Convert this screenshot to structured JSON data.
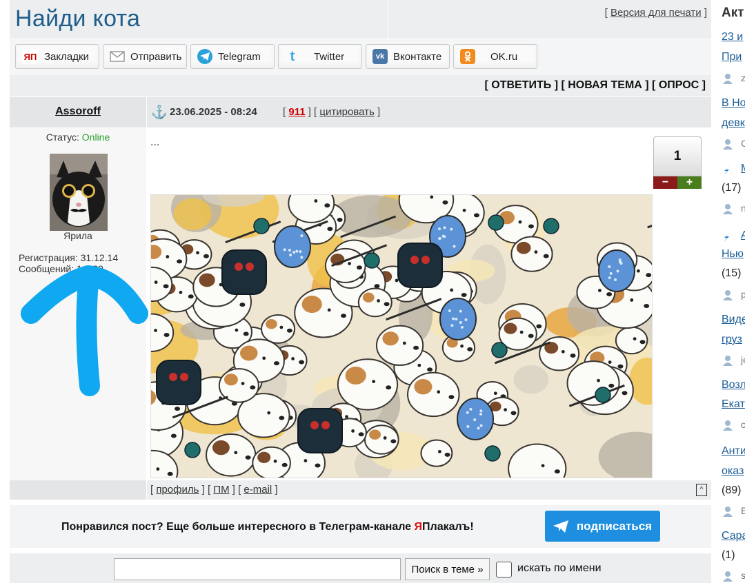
{
  "header": {
    "title": "Найди кота",
    "print_link": "Версия для печати"
  },
  "share": [
    {
      "label": "Закладки",
      "icon": "yap-icon"
    },
    {
      "label": "Отправить",
      "icon": "envelope-icon"
    },
    {
      "label": "Telegram",
      "icon": "telegram-icon"
    },
    {
      "label": "Twitter",
      "icon": "twitter-icon"
    },
    {
      "label": "Вконтакте",
      "icon": "vk-icon"
    },
    {
      "label": "OK.ru",
      "icon": "ok-icon"
    }
  ],
  "actions": "[ ОТВЕТИТЬ ] [ НОВАЯ ТЕМА ] [ ОПРОС ]",
  "post": {
    "author": "Assoroff",
    "date": "23.06.2025 - 08:24",
    "num": "911",
    "quote": "цитировать",
    "status_label": "Статус:",
    "status_value": "Online",
    "user_name": "Ярила",
    "reg_label": "Регистрация: 31.12.14",
    "msg_label": "Сообщений: 14929",
    "text": "...",
    "rating": "1",
    "rate_minus": "−",
    "rate_plus": "+",
    "links": {
      "profile": "профиль",
      "pm": "ПМ",
      "email": "e-mail"
    },
    "top_link": "^"
  },
  "promo": {
    "text_before": "Понравился пост? Еще больше интересного в Телеграм-канале ",
    "brand_r": "Я",
    "brand_rest": "Плакалъ!",
    "button": "подписаться"
  },
  "search": {
    "button": "Поиск в теме »",
    "checkbox_label": "искать по имени"
  },
  "sidebar": {
    "heading": "Акт",
    "lines": [
      {
        "text": "23 и",
        "type": "link"
      },
      {
        "text": "При",
        "type": "link"
      },
      {
        "text": "z",
        "type": "user"
      },
      {
        "text": "В Но",
        "type": "link"
      },
      {
        "text": "девк",
        "type": "link"
      },
      {
        "text": "С",
        "type": "user"
      },
      {
        "text": "М",
        "type": "arrow-link"
      },
      {
        "text": "(17)",
        "type": "count"
      },
      {
        "text": "n",
        "type": "user"
      },
      {
        "text": "А",
        "type": "arrow-link"
      },
      {
        "text": "Нью",
        "type": "link"
      },
      {
        "text": "(15)",
        "type": "count"
      },
      {
        "text": "р",
        "type": "user"
      },
      {
        "text": "Виде",
        "type": "link"
      },
      {
        "text": "груз",
        "type": "link"
      },
      {
        "text": "jє",
        "type": "user"
      },
      {
        "text": "Возл",
        "type": "link"
      },
      {
        "text": "Екат",
        "type": "link"
      },
      {
        "text": "с",
        "type": "user"
      },
      {
        "text": "Анти",
        "type": "link"
      },
      {
        "text": "оказ",
        "type": "link"
      },
      {
        "text": "(89)",
        "type": "count"
      },
      {
        "text": "Е",
        "type": "user"
      },
      {
        "text": "Сара",
        "type": "link"
      },
      {
        "text": "(1)",
        "type": "count"
      },
      {
        "text": "s",
        "type": "user"
      }
    ]
  },
  "colors": {
    "title": "#1f5d8a",
    "link": "#1a5d96",
    "accent_red": "#d10000",
    "subscribe": "#1e8fe0",
    "marker": "#10a8f0"
  }
}
